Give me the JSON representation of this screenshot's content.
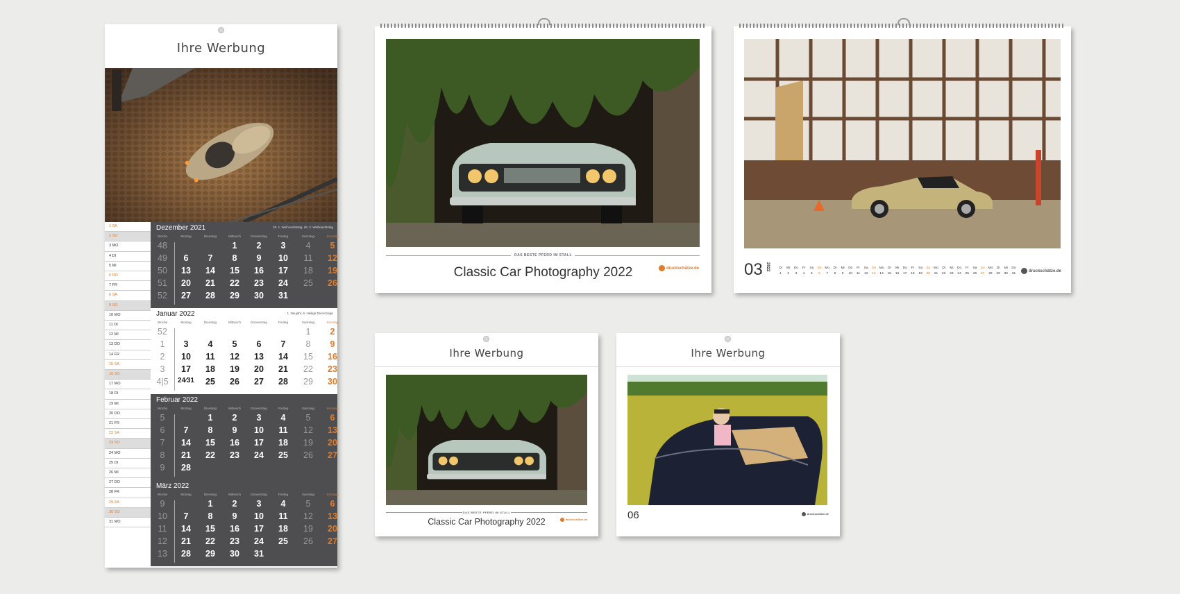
{
  "colors": {
    "accent": "#e07b2a",
    "dark_panel": "#4e4e50",
    "background": "#ececeb"
  },
  "planner": {
    "ad_text": "Ihre Werbung",
    "days": [
      {
        "t": "1 SA",
        "s": "orange"
      },
      {
        "t": "2 SO",
        "s": "orange-grey"
      },
      {
        "t": "3 MO",
        "s": ""
      },
      {
        "t": "4 DI",
        "s": ""
      },
      {
        "t": "5 MI",
        "s": ""
      },
      {
        "t": "6 DO",
        "s": "orange"
      },
      {
        "t": "7 FR",
        "s": ""
      },
      {
        "t": "8 SA",
        "s": "orange"
      },
      {
        "t": "9 SO",
        "s": "orange-grey"
      },
      {
        "t": "10 MO",
        "s": ""
      },
      {
        "t": "11 DI",
        "s": ""
      },
      {
        "t": "12 MI",
        "s": ""
      },
      {
        "t": "13 DO",
        "s": ""
      },
      {
        "t": "14 FR",
        "s": ""
      },
      {
        "t": "15 SA",
        "s": "orange"
      },
      {
        "t": "16 SO",
        "s": "orange-grey"
      },
      {
        "t": "17 MO",
        "s": ""
      },
      {
        "t": "18 DI",
        "s": ""
      },
      {
        "t": "19 MI",
        "s": ""
      },
      {
        "t": "20 DO",
        "s": ""
      },
      {
        "t": "21 FR",
        "s": ""
      },
      {
        "t": "22 SA",
        "s": "orange"
      },
      {
        "t": "23 SO",
        "s": "orange-grey"
      },
      {
        "t": "24 MO",
        "s": ""
      },
      {
        "t": "25 DI",
        "s": ""
      },
      {
        "t": "26 MI",
        "s": ""
      },
      {
        "t": "27 DO",
        "s": ""
      },
      {
        "t": "28 FR",
        "s": ""
      },
      {
        "t": "29 SA",
        "s": "orange"
      },
      {
        "t": "30 SO",
        "s": "orange-grey"
      },
      {
        "t": "31 MO",
        "s": ""
      }
    ],
    "headers": [
      "Woche",
      "Montag",
      "Dienstag",
      "Mittwoch",
      "Donnerstag",
      "Freitag",
      "Samstag",
      "Sonntag"
    ],
    "months": [
      {
        "name": "Dezember 2021",
        "note": "25. 1. Weihnachtstag, 26. 2. Weihnachtstag",
        "style": "dark",
        "rows": [
          [
            "48",
            "",
            "",
            "1",
            "2",
            "3",
            "4",
            "5"
          ],
          [
            "49",
            "6",
            "7",
            "8",
            "9",
            "10",
            "11",
            "12"
          ],
          [
            "50",
            "13",
            "14",
            "15",
            "16",
            "17",
            "18",
            "19"
          ],
          [
            "51",
            "20",
            "21",
            "22",
            "23",
            "24",
            "25",
            "26"
          ],
          [
            "52",
            "27",
            "28",
            "29",
            "30",
            "31",
            "",
            ""
          ]
        ]
      },
      {
        "name": "Januar 2022",
        "note": "1. Neujahr, 6. Heilige Drei Könige",
        "style": "light",
        "rows": [
          [
            "52",
            "",
            "",
            "",
            "",
            "",
            "1",
            "2"
          ],
          [
            "1",
            "3",
            "4",
            "5",
            "6",
            "7",
            "8",
            "9"
          ],
          [
            "2",
            "10",
            "11",
            "12",
            "13",
            "14",
            "15",
            "16"
          ],
          [
            "3",
            "17",
            "18",
            "19",
            "20",
            "21",
            "22",
            "23"
          ],
          [
            "4|5",
            "24⁄31",
            "25",
            "26",
            "27",
            "28",
            "29",
            "30"
          ]
        ]
      },
      {
        "name": "Februar 2022",
        "note": "",
        "style": "dark",
        "rows": [
          [
            "5",
            "",
            "1",
            "2",
            "3",
            "4",
            "5",
            "6"
          ],
          [
            "6",
            "7",
            "8",
            "9",
            "10",
            "11",
            "12",
            "13"
          ],
          [
            "7",
            "14",
            "15",
            "16",
            "17",
            "18",
            "19",
            "20"
          ],
          [
            "8",
            "21",
            "22",
            "23",
            "24",
            "25",
            "26",
            "27"
          ],
          [
            "9",
            "28",
            "",
            "",
            "",
            "",
            "",
            ""
          ]
        ]
      },
      {
        "name": "März 2022",
        "note": "",
        "style": "dark",
        "rows": [
          [
            "9",
            "",
            "1",
            "2",
            "3",
            "4",
            "5",
            "6"
          ],
          [
            "10",
            "7",
            "8",
            "9",
            "10",
            "11",
            "12",
            "13"
          ],
          [
            "11",
            "14",
            "15",
            "16",
            "17",
            "18",
            "19",
            "20"
          ],
          [
            "12",
            "21",
            "22",
            "23",
            "24",
            "25",
            "26",
            "27"
          ],
          [
            "13",
            "28",
            "29",
            "30",
            "31",
            "",
            "",
            ""
          ]
        ]
      }
    ]
  },
  "calendar_large_1": {
    "caption": "DAS BESTE PFERD IM STALL",
    "title": "Classic Car Photography 2022",
    "logo": "druckschätze.de"
  },
  "calendar_large_2": {
    "month_number": "03",
    "year_vertical": "2022",
    "logo": "druckschätze.de",
    "weekday_letters": [
      "Di",
      "Mi",
      "Do",
      "Fr",
      "Sa",
      "So",
      "Mo",
      "Di",
      "Mi",
      "Do",
      "Fr",
      "Sa",
      "So",
      "Mo",
      "Di",
      "Mi",
      "Do",
      "Fr",
      "Sa",
      "So",
      "Mo",
      "Di",
      "Mi",
      "Do",
      "Fr",
      "Sa",
      "So",
      "Mo",
      "Di",
      "Mi",
      "Do"
    ],
    "days": [
      "1",
      "2",
      "3",
      "4",
      "5",
      "6",
      "7",
      "8",
      "9",
      "10",
      "11",
      "12",
      "13",
      "14",
      "15",
      "16",
      "17",
      "18",
      "19",
      "20",
      "21",
      "22",
      "23",
      "24",
      "25",
      "26",
      "27",
      "28",
      "29",
      "30",
      "31"
    ]
  },
  "calendar_small_1": {
    "ad_text": "Ihre Werbung",
    "caption": "DAS BESTE PFERD IM STALL",
    "title": "Classic Car Photography 2022",
    "logo": "druckschätze.de"
  },
  "calendar_small_2": {
    "ad_text": "Ihre Werbung",
    "month_number": "06",
    "logo": "druckschätze.de"
  }
}
